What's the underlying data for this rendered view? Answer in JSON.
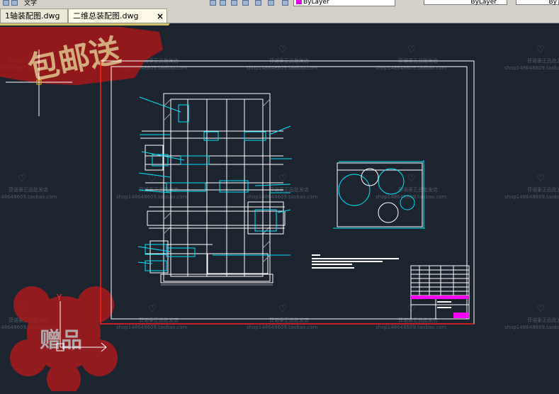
{
  "toolbar": {
    "text_style": "文字",
    "layer_value": "ByLayer",
    "linetype_value": "ByLayer",
    "lineweight_value": "By"
  },
  "tabs": [
    {
      "label": "1轴装配图.dwg",
      "active": false
    },
    {
      "label": "二维总装配图.dwg",
      "active": true,
      "close": "×"
    }
  ],
  "watermark": {
    "line1": "菲诺豪正品批发店",
    "line2": "shop148648609.taobao.com",
    "stamp_top": "包邮送",
    "stamp_bottom": "赠品"
  },
  "ucs": {
    "y_label": "Y"
  },
  "colors": {
    "canvas": "#1c2430",
    "drawing_line": "#ffffff",
    "dimension": "#00e5ff",
    "title_highlight": "#ff00ff",
    "frame_red": "#ff2020",
    "watermark_red": "#c81e1e"
  }
}
